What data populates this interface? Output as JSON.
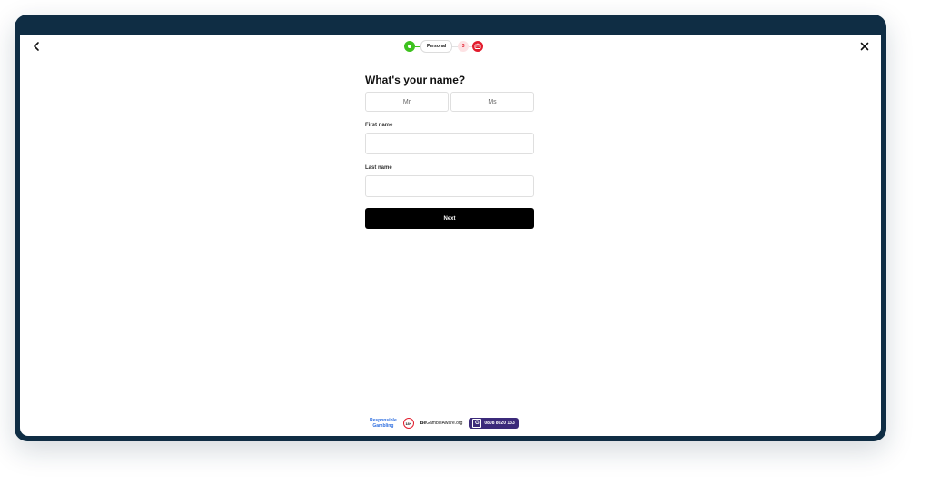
{
  "header": {
    "back_icon": "chevron-left-icon",
    "close_icon": "close-icon"
  },
  "stepper": {
    "current_label": "Personal",
    "next_step_number": "3",
    "final_step_icon": "robot-icon",
    "colors": {
      "done": "#3ec21f",
      "accent": "#e21b2c"
    }
  },
  "form": {
    "title": "What's your name?",
    "title_options": [
      "Mr",
      "Ms"
    ],
    "first_name_label": "First name",
    "first_name_value": "",
    "last_name_label": "Last name",
    "last_name_value": "",
    "submit_label": "Next"
  },
  "footer": {
    "responsible_line1": "Responsible",
    "responsible_line2": "Gambling",
    "age_badge": "18+",
    "begambleaware_bold": "Be",
    "begambleaware_rest": "GambleAware",
    "begambleaware_suffix": ".org",
    "gamcare_letter": "G",
    "gamcare_phone": "0808 8020 133"
  }
}
